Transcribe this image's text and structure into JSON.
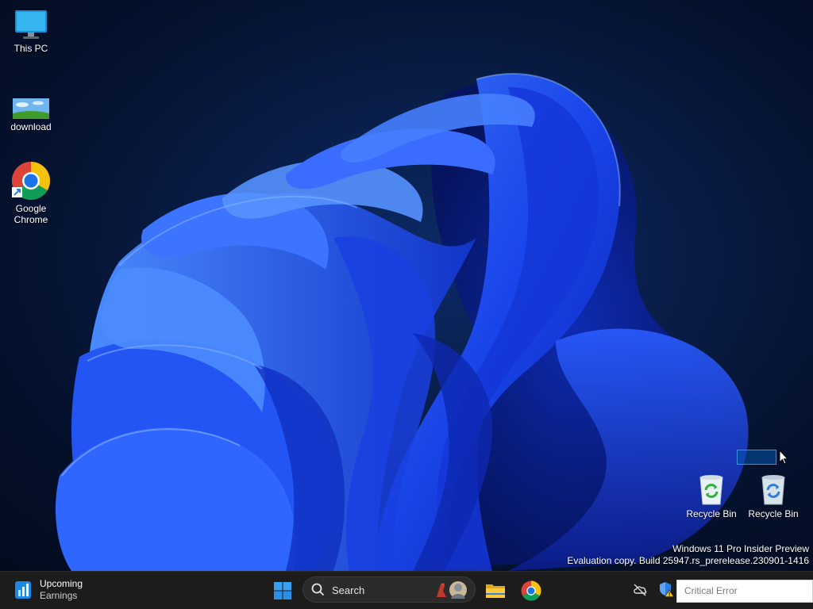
{
  "desktop": {
    "icons": [
      {
        "label": "This PC",
        "icon": "monitor-icon"
      },
      {
        "label": "download",
        "icon": "image-thumbnail-icon"
      },
      {
        "label_line1": "Google",
        "label_line2": "Chrome",
        "icon": "chrome-icon"
      },
      {
        "label": "Recycle Bin",
        "icon": "recycle-bin-full-icon"
      },
      {
        "label": "Recycle Bin",
        "icon": "recycle-bin-empty-icon"
      }
    ],
    "watermark": {
      "line1": "Windows 11 Pro Insider Preview",
      "line2": "Evaluation copy. Build 25947.rs_prerelease.230901-1416"
    }
  },
  "taskbar": {
    "widget": {
      "title": "Upcoming",
      "subtitle": "Earnings",
      "icon": "chart-widget-icon"
    },
    "start_icon": "windows-logo-icon",
    "search": {
      "placeholder": "Search"
    },
    "apps": [
      {
        "name": "File Explorer",
        "icon": "folder-icon"
      },
      {
        "name": "Google Chrome",
        "icon": "chrome-icon"
      }
    ],
    "tray": {
      "icons": [
        "cloud-offline-icon",
        "defender-warning-icon"
      ],
      "notification_text": "Critical Error"
    }
  },
  "colors": {
    "taskbar_bg": "#1c1c1c",
    "accent": "#0078d4",
    "wallpaper_bloom": "#1f4fff"
  }
}
